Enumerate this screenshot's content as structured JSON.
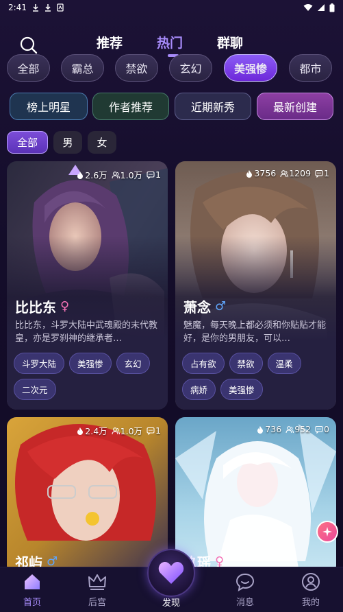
{
  "status_bar": {
    "time": "2:41"
  },
  "top_tabs": [
    {
      "label": "推荐"
    },
    {
      "label": "热门"
    },
    {
      "label": "群聊"
    }
  ],
  "categories": [
    {
      "label": "全部"
    },
    {
      "label": "霸总"
    },
    {
      "label": "禁欲"
    },
    {
      "label": "玄幻"
    },
    {
      "label": "美强惨"
    },
    {
      "label": "都市"
    }
  ],
  "sub_filters": [
    {
      "label": "榜上明星"
    },
    {
      "label": "作者推荐"
    },
    {
      "label": "近期新秀"
    },
    {
      "label": "最新创建"
    }
  ],
  "gender_filters": [
    {
      "label": "全部"
    },
    {
      "label": "男"
    },
    {
      "label": "女"
    }
  ],
  "cards": [
    {
      "heat": "2.6万",
      "followers": "1.0万",
      "comments": "1",
      "name": "比比东",
      "gender": "♀",
      "desc": "比比东，斗罗大陆中武魂殿的末代教皇，亦是罗刹神的继承者…",
      "tags": [
        "斗罗大陆",
        "美强惨",
        "玄幻",
        "二次元"
      ]
    },
    {
      "heat": "3756",
      "followers": "1209",
      "comments": "1",
      "name": "萧念",
      "gender": "♂",
      "desc": "魅魔，每天晚上都必须和你贴贴才能好，是你的男朋友，可以…",
      "tags": [
        "占有欲",
        "禁欲",
        "温柔",
        "病娇",
        "美强惨"
      ]
    },
    {
      "heat": "2.4万",
      "followers": "1.0万",
      "comments": "1",
      "name": "祁屿",
      "gender": "♂"
    },
    {
      "heat": "736",
      "followers": "952",
      "comments": "0",
      "name": "玖瑶",
      "gender": "♀"
    }
  ],
  "bottom_nav": [
    {
      "label": "首页",
      "icon": "home-icon"
    },
    {
      "label": "后宫",
      "icon": "crown-icon"
    },
    {
      "label": "发现",
      "icon": "heart-icon"
    },
    {
      "label": "消息",
      "icon": "chat-icon"
    },
    {
      "label": "我的",
      "icon": "profile-icon"
    }
  ],
  "colors": {
    "accent": "#a78bfa",
    "female": "#f472b6",
    "male": "#60a5fa"
  }
}
